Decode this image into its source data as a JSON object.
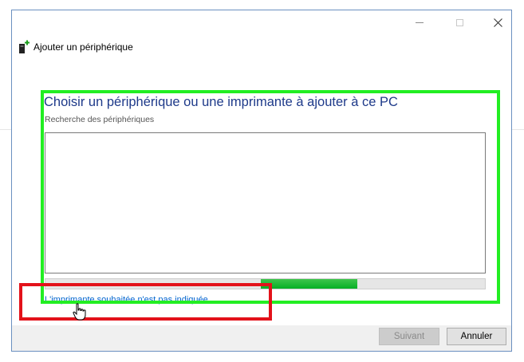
{
  "window": {
    "title": "Ajouter un périphérique",
    "controls": {
      "minimize": "minimize-icon",
      "maximize": "maximize-icon",
      "close": "close-icon"
    }
  },
  "main": {
    "heading": "Choisir un périphérique ou une imprimante à ajouter à ce PC",
    "status": "Recherche des périphériques",
    "progress_fraction": 0.22,
    "progress_start_fraction": 0.49,
    "link": "L'imprimante souhaitée n'est pas indiquée"
  },
  "buttons": {
    "next": "Suivant",
    "cancel": "Annuler"
  },
  "annotations": {
    "green_box_color": "#22ee22",
    "red_box_color": "#e3121a"
  },
  "colors": {
    "heading": "#1e3a8a",
    "link": "#0066cc",
    "progress": "#06b025"
  }
}
